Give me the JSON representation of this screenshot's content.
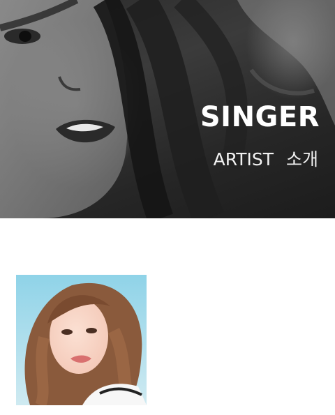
{
  "hero": {
    "title": "SINGER",
    "subtitle": "ARTIST 소개",
    "image_icon": "artist-banner-image",
    "tone": "grayscale"
  },
  "artist_card": {
    "image_icon": "artist-profile-photo",
    "colors": {
      "sky": "#8fd3e8",
      "hair": "#8a5a3c",
      "skin": "#f4c9b8",
      "lips": "#d9706f"
    }
  }
}
